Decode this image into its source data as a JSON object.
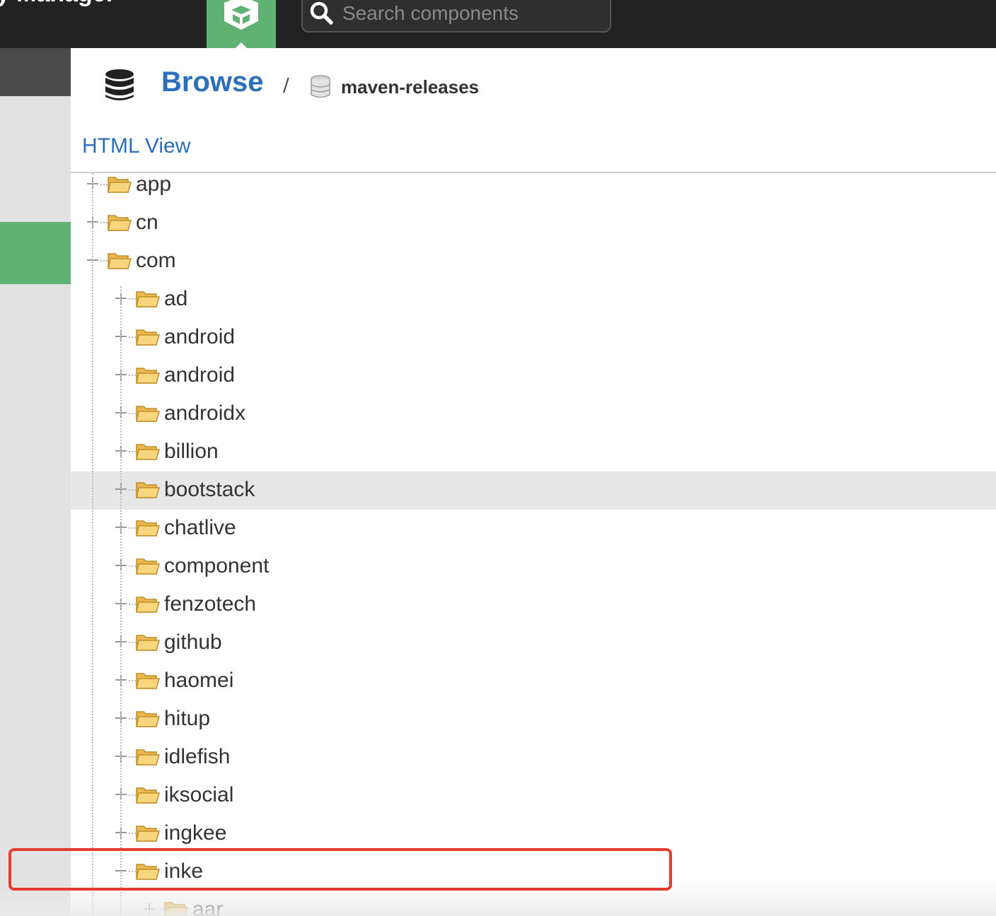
{
  "header": {
    "app_title": "itory Manager",
    "search_placeholder": "Search components"
  },
  "breadcrumb": {
    "root": "Browse",
    "separator": "/",
    "repository": "maven-releases"
  },
  "view_link": "HTML View",
  "tree": [
    {
      "label": "app",
      "level": 0,
      "expanded": false
    },
    {
      "label": "cn",
      "level": 0,
      "expanded": false
    },
    {
      "label": "com",
      "level": 0,
      "expanded": true
    },
    {
      "label": "ad",
      "level": 1,
      "expanded": false
    },
    {
      "label": "android",
      "level": 1,
      "expanded": false
    },
    {
      "label": "android",
      "level": 1,
      "expanded": false
    },
    {
      "label": "androidx",
      "level": 1,
      "expanded": false
    },
    {
      "label": "billion",
      "level": 1,
      "expanded": false
    },
    {
      "label": "bootstack",
      "level": 1,
      "expanded": false,
      "hover": true
    },
    {
      "label": "chatlive",
      "level": 1,
      "expanded": false
    },
    {
      "label": "component",
      "level": 1,
      "expanded": false
    },
    {
      "label": "fenzotech",
      "level": 1,
      "expanded": false
    },
    {
      "label": "github",
      "level": 1,
      "expanded": false
    },
    {
      "label": "haomei",
      "level": 1,
      "expanded": false
    },
    {
      "label": "hitup",
      "level": 1,
      "expanded": false
    },
    {
      "label": "idlefish",
      "level": 1,
      "expanded": false
    },
    {
      "label": "iksocial",
      "level": 1,
      "expanded": false
    },
    {
      "label": "ingkee",
      "level": 1,
      "expanded": false
    },
    {
      "label": "inke",
      "level": 1,
      "expanded": true,
      "highlighted": true
    },
    {
      "label": "aar",
      "level": 2,
      "expanded": false
    }
  ],
  "icons": {
    "browse_mode": "cube-icon",
    "search": "search-icon",
    "breadcrumb_root": "database-icon",
    "breadcrumb_repo": "repository-icon",
    "folder": "folder-open-icon",
    "expand": "plus-icon",
    "collapse": "minus-icon"
  },
  "colors": {
    "topbar": "#222222",
    "accent_green": "#5fb174",
    "link_blue": "#2b6fbb",
    "highlight_border": "#e53b2c",
    "row_hover": "#e7e7e7"
  }
}
